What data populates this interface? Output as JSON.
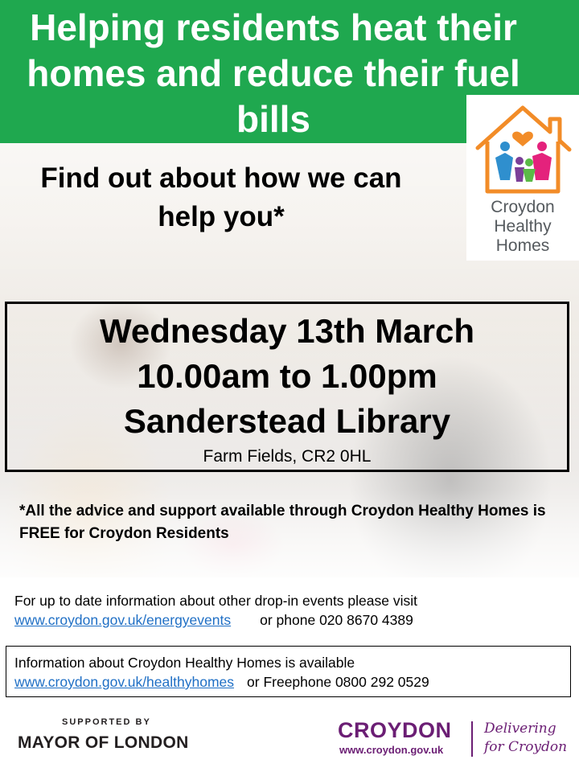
{
  "header": {
    "headline": "Helping residents heat their homes and reduce their fuel bills",
    "background_color": "#1fa84f"
  },
  "logo": {
    "line1": "Croydon",
    "line2": "Healthy",
    "line3": "Homes",
    "icon": "house-family-icon"
  },
  "subhead": "Find out about how we can help you*",
  "event": {
    "date": "Wednesday 13th March",
    "time": "10.00am to 1.00pm",
    "venue": "Sanderstead Library",
    "address": "Farm Fields, CR2 0HL"
  },
  "note": "*All the advice and support available through Croydon Healthy Homes is FREE for Croydon Residents",
  "info_events": {
    "text": "For up to date information about other drop-in events please visit",
    "link": "www.croydon.gov.uk/energyevents",
    "phone_text": "or phone 020 8670 4389"
  },
  "info_homes": {
    "text": "Information about Croydon Healthy Homes is available",
    "link": "www.croydon.gov.uk/healthyhomes",
    "phone_text": "or Freephone 0800 292 0529"
  },
  "footer": {
    "supported_by": "SUPPORTED BY",
    "mayor": "MAYOR OF LONDON",
    "croydon": "CROYDON",
    "croydon_url": "www.croydon.gov.uk",
    "tagline1": "Delivering",
    "tagline2": "for Croydon",
    "brand_color": "#6b1e74"
  }
}
